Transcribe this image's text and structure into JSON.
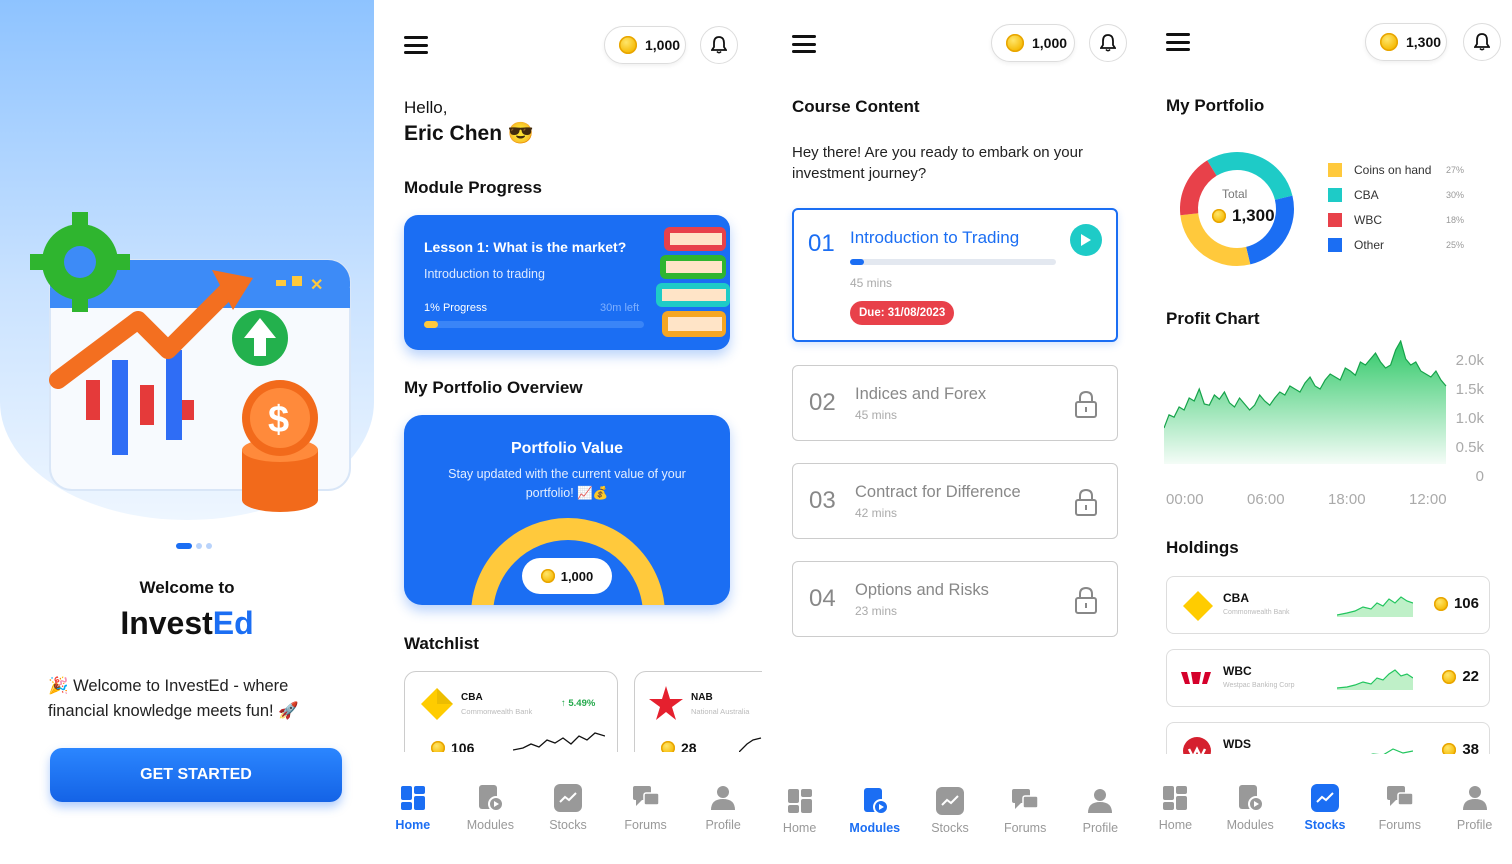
{
  "colors": {
    "primary": "#1b6ef3",
    "accent_yellow": "#ffc93c",
    "danger": "#e8414a",
    "teal": "#1ecbc7",
    "green": "#22c55e"
  },
  "welcome": {
    "heading": "Welcome to",
    "brand_part1": "Invest",
    "brand_part2": "Ed",
    "tagline": "Welcome to InvestEd - where financial knowledge meets fun!",
    "cta": "GET STARTED"
  },
  "home": {
    "coins": "1,000",
    "greeting": "Hello,",
    "user": "Eric Chen",
    "module_progress_title": "Module Progress",
    "lesson_title": "Lesson 1: What is the market?",
    "lesson_sub": "Introduction to trading",
    "progress_label": "1% Progress",
    "progress_fraction": 0.01,
    "time_left": "30m left",
    "portfolio_overview_title": "My Portfolio Overview",
    "portfolio_title": "Portfolio Value",
    "portfolio_sub": "Stay updated with the current value of your portfolio! 📈💰",
    "portfolio_value": "1,000",
    "watchlist_title": "Watchlist",
    "watchlist": [
      {
        "ticker": "CBA",
        "name": "Commonwealth Bank",
        "change": "↑ 5.49%",
        "value": "106"
      },
      {
        "ticker": "NAB",
        "name": "National Australia",
        "value": "28"
      }
    ]
  },
  "modules": {
    "coins": "1,000",
    "title": "Course Content",
    "intro": "Hey there! Are you ready to embark on your investment journey?",
    "items": [
      {
        "num": "01",
        "title": "Introduction to Trading",
        "mins": "45 mins",
        "due": "Due: 31/08/2023"
      },
      {
        "num": "02",
        "title": "Indices and Forex",
        "mins": "45 mins"
      },
      {
        "num": "03",
        "title": "Contract for Difference",
        "mins": "42 mins"
      },
      {
        "num": "04",
        "title": "Options and Risks",
        "mins": "23 mins"
      }
    ]
  },
  "stocks": {
    "coins": "1,300",
    "portfolio_title": "My Portfolio",
    "total_label": "Total",
    "total_value": "1,300",
    "legend": [
      {
        "label": "Coins on hand",
        "pct": "27%",
        "color": "#ffc93c"
      },
      {
        "label": "CBA",
        "pct": "30%",
        "color": "#1ecbc7"
      },
      {
        "label": "WBC",
        "pct": "18%",
        "color": "#e8414a"
      },
      {
        "label": "Other",
        "pct": "25%",
        "color": "#1b6ef3"
      }
    ],
    "profit_title": "Profit Chart",
    "holdings_title": "Holdings",
    "holdings": [
      {
        "ticker": "CBA",
        "name": "Commonwealth Bank",
        "value": "106"
      },
      {
        "ticker": "WBC",
        "name": "Westpac Banking Corp",
        "value": "22"
      },
      {
        "ticker": "WDS",
        "name": "",
        "value": "38"
      }
    ]
  },
  "nav": {
    "home": "Home",
    "modules": "Modules",
    "stocks": "Stocks",
    "forums": "Forums",
    "profile": "Profile"
  },
  "chart_data": [
    {
      "type": "pie",
      "categories": [
        "Coins on hand",
        "CBA",
        "WBC",
        "Other"
      ],
      "values": [
        27,
        30,
        18,
        25
      ],
      "title": ""
    },
    {
      "type": "area",
      "title": "Profit Chart",
      "x_ticks": [
        "00:00",
        "06:00",
        "18:00",
        "12:00"
      ],
      "y_ticks": [
        "2.0k",
        "1.5k",
        "1.0k",
        "0.5k",
        "0"
      ],
      "ylim": [
        0,
        2000
      ],
      "values": [
        600,
        820,
        780,
        950,
        900,
        1100,
        1050,
        1250,
        1000,
        980,
        1150,
        1080,
        1200,
        1020,
        950,
        1100,
        1000,
        900,
        980,
        1150,
        1050,
        980,
        1100,
        1200,
        1150,
        1300,
        1250,
        1200,
        1350,
        1450,
        1300,
        1250,
        1400,
        1500,
        1450,
        1400,
        1600,
        1550,
        1480,
        1700,
        1650,
        1750,
        1850,
        1700,
        1600,
        1650,
        1900,
        2050,
        1750,
        1650,
        1700,
        1550,
        1500,
        1450,
        1550,
        1400,
        1300
      ]
    }
  ]
}
